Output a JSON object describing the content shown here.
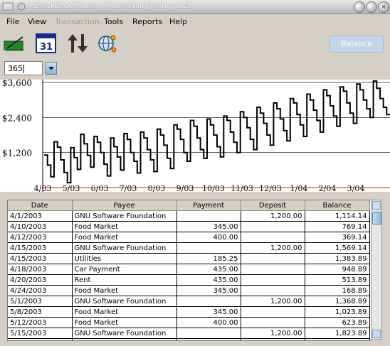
{
  "window": {
    "title": "CheckBook Tracker - /home/tony/money.test",
    "close_label": "×"
  },
  "menu": {
    "items": [
      {
        "label": "File",
        "enabled": true
      },
      {
        "label": "View",
        "enabled": true
      },
      {
        "label": "Transaction",
        "enabled": false
      },
      {
        "label": "Tools",
        "enabled": true
      },
      {
        "label": "Reports",
        "enabled": true
      },
      {
        "label": "Help",
        "enabled": true
      }
    ]
  },
  "toolbar": {
    "icons": [
      "checkbook-pen-icon",
      "calendar-icon",
      "transfer-arrows-icon",
      "globe-network-icon"
    ],
    "calendar_day": "31",
    "balance_label": "Balance"
  },
  "days_field": {
    "value": "365"
  },
  "chart_data": {
    "type": "line",
    "y_ticks": [
      "$3,600",
      "$2,400",
      "$1,200"
    ],
    "y_tick_values": [
      3600,
      2400,
      1200
    ],
    "x_ticks": [
      "4/03",
      "5/03",
      "6/03",
      "7/03",
      "8/03",
      "9/03",
      "10/03",
      "11/03",
      "12/03",
      "1/04",
      "2/04",
      "3/04"
    ],
    "ylim": [
      0,
      3700
    ],
    "grid": true,
    "line_color": "#000000",
    "zero_line_color": "#cc2222",
    "series": [
      {
        "values": [
          1114,
          769,
          369,
          1569,
          1384,
          949,
          514,
          169,
          1369,
          1024,
          624,
          1824,
          1500,
          1100,
          700,
          1750,
          1550,
          1200,
          800,
          400,
          1700,
          1400,
          1050,
          600,
          1850,
          1650,
          1200,
          900,
          500,
          1900,
          1700,
          1300,
          950,
          550,
          2000,
          1800,
          1450,
          1000,
          650,
          2150,
          2000,
          1650,
          1200,
          900,
          2300,
          2100,
          1700,
          1300,
          1000,
          2350,
          2150,
          1800,
          1400,
          1050,
          2450,
          2300,
          1900,
          1550,
          1200,
          2600,
          2400,
          2050,
          1650,
          1300,
          2750,
          2550,
          2200,
          1800,
          1450,
          2900,
          2700,
          2350,
          1950,
          1600,
          3050,
          2900,
          2500,
          2150,
          1750,
          3200,
          3000,
          2650,
          2300,
          1900,
          3350,
          3150,
          2800,
          2450,
          2100,
          3450,
          3300,
          2900,
          2550,
          2200,
          3550,
          3350,
          3000,
          2700,
          2400,
          3650,
          3400,
          3050,
          2750,
          2500
        ]
      }
    ]
  },
  "table": {
    "columns": [
      "Date",
      "Payee",
      "Payment",
      "Deposit",
      "Balance"
    ],
    "rows": [
      [
        "4/1/2003",
        "GNU Software Foundation",
        "",
        "1,200.00",
        "1,114.14"
      ],
      [
        "4/10/2003",
        "Food Market",
        "345.00",
        "",
        "769.14"
      ],
      [
        "4/12/2003",
        "Food Market",
        "400.00",
        "",
        "369.14"
      ],
      [
        "4/15/2003",
        "GNU Software Foundation",
        "",
        "1,200.00",
        "1,569.14"
      ],
      [
        "4/15/2003",
        "Utilities",
        "185.25",
        "",
        "1,383.89"
      ],
      [
        "4/18/2003",
        "Car Payment",
        "435.00",
        "",
        "948.89"
      ],
      [
        "4/20/2003",
        "Rent",
        "435.00",
        "",
        "513.89"
      ],
      [
        "4/24/2003",
        "Food Market",
        "345.00",
        "",
        "168.89"
      ],
      [
        "5/1/2003",
        "GNU Software Foundation",
        "",
        "1,200.00",
        "1,368.89"
      ],
      [
        "5/8/2003",
        "Food Market",
        "345.00",
        "",
        "1,023.89"
      ],
      [
        "5/12/2003",
        "Food Market",
        "400.00",
        "",
        "623.89"
      ],
      [
        "5/15/2003",
        "GNU Software Foundation",
        "",
        "1,200.00",
        "1,823.89"
      ],
      [
        "",
        "",
        "",
        "",
        ""
      ]
    ]
  }
}
